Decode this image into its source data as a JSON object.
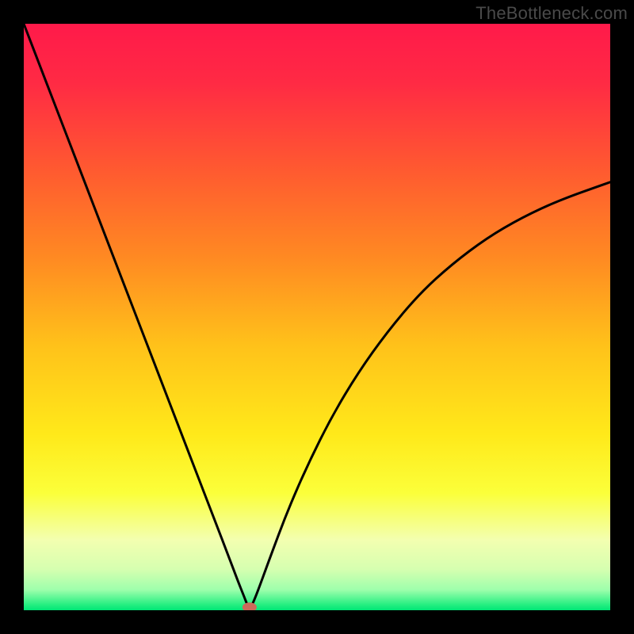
{
  "watermark": "TheBottleneck.com",
  "chart_data": {
    "type": "line",
    "title": "",
    "xlabel": "",
    "ylabel": "",
    "xlim": [
      0,
      100
    ],
    "ylim": [
      0,
      100
    ],
    "gradient_stops": [
      {
        "offset": 0,
        "color": "#ff1a4a"
      },
      {
        "offset": 0.1,
        "color": "#ff2a44"
      },
      {
        "offset": 0.25,
        "color": "#ff5a30"
      },
      {
        "offset": 0.4,
        "color": "#ff8a22"
      },
      {
        "offset": 0.55,
        "color": "#ffc21a"
      },
      {
        "offset": 0.7,
        "color": "#ffe91a"
      },
      {
        "offset": 0.8,
        "color": "#fbff3a"
      },
      {
        "offset": 0.88,
        "color": "#f3ffb0"
      },
      {
        "offset": 0.93,
        "color": "#d6ffb0"
      },
      {
        "offset": 0.965,
        "color": "#9effac"
      },
      {
        "offset": 0.99,
        "color": "#28ef82"
      },
      {
        "offset": 1.0,
        "color": "#00e676"
      }
    ],
    "series": [
      {
        "name": "bottleneck_curve",
        "x": [
          0.0,
          2.5,
          5.0,
          7.5,
          10.0,
          12.5,
          15.0,
          17.5,
          20.0,
          22.5,
          25.0,
          27.5,
          30.0,
          32.5,
          35.0,
          36.5,
          37.5,
          38.0,
          38.4,
          38.6,
          39.0,
          40.0,
          42.0,
          45.0,
          48.5,
          52.5,
          57.0,
          62.0,
          67.5,
          73.0,
          79.0,
          85.0,
          91.5,
          100.0
        ],
        "y": [
          100.0,
          93.5,
          87.0,
          80.5,
          74.0,
          67.5,
          61.0,
          54.5,
          48.0,
          41.5,
          35.0,
          28.5,
          22.0,
          15.5,
          9.0,
          5.0,
          2.5,
          1.2,
          0.4,
          0.4,
          1.0,
          3.5,
          9.0,
          17.0,
          25.0,
          33.0,
          40.5,
          47.5,
          54.0,
          59.0,
          63.5,
          67.0,
          70.0,
          73.0
        ]
      }
    ],
    "marker": {
      "x": 38.5,
      "y": 0.5,
      "color": "#cc6a5a",
      "rx": 9,
      "ry": 6
    },
    "legend": [],
    "annotations": []
  }
}
